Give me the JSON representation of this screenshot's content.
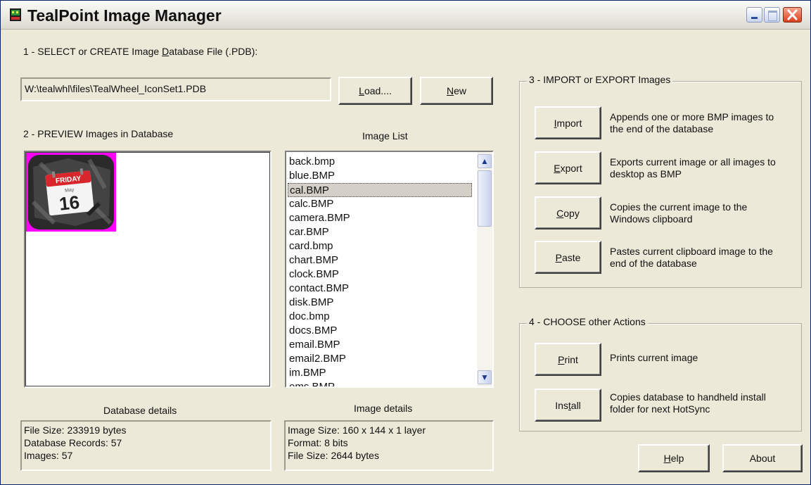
{
  "window": {
    "title": "TealPoint Image Manager"
  },
  "section1": {
    "label_pre": "1 - SELECT or CREATE Image ",
    "label_u": "D",
    "label_post": "atabase File (.PDB):",
    "path_value": "W:\\tealwhl\\files\\TealWheel_IconSet1.PDB",
    "load_u": "L",
    "load_rest": "oad....",
    "new_u": "N",
    "new_rest": "ew"
  },
  "section2": {
    "label": "2 - PREVIEW Images in Database",
    "preview_image": {
      "day": "FRIDAY",
      "month": "May",
      "date": "16"
    },
    "image_list_label": "Image List",
    "image_list": [
      "back.bmp",
      "blue.BMP",
      "cal.BMP",
      "calc.BMP",
      "camera.BMP",
      "car.BMP",
      "card.bmp",
      "chart.BMP",
      "clock.BMP",
      "contact.BMP",
      "disk.BMP",
      "doc.bmp",
      "docs.BMP",
      "email.BMP",
      "email2.BMP",
      "im.BMP",
      "ems.BMP"
    ],
    "selected_item": "cal.BMP"
  },
  "database_details": {
    "label": "Database details",
    "lines": [
      "File Size: 233919 bytes",
      "Database Records: 57",
      "Images: 57"
    ]
  },
  "image_details": {
    "label": "Image details",
    "lines": [
      "Image Size: 160 x 144 x 1 layer",
      "Format: 8 bits",
      "File Size: 2644 bytes"
    ]
  },
  "section3": {
    "legend": "3 - IMPORT or EXPORT Images",
    "import": {
      "u": "I",
      "rest": "mport",
      "desc": "Appends one or more BMP images to the end of the database"
    },
    "export": {
      "u": "E",
      "rest": "xport",
      "desc": "Exports current image or all images to desktop as BMP"
    },
    "copy": {
      "u": "C",
      "rest": "opy",
      "desc": "Copies the current image to the Windows clipboard"
    },
    "paste": {
      "u": "P",
      "rest": "aste",
      "desc": "Pastes current clipboard image to the end of the database"
    }
  },
  "section4": {
    "legend": "4 - CHOOSE other Actions",
    "print": {
      "u": "P",
      "rest": "rint",
      "desc": "Prints current image"
    },
    "install": {
      "pre": "Ins",
      "u": "t",
      "rest": "all",
      "desc": "Copies database to handheld install folder for next HotSync"
    }
  },
  "footer": {
    "help_u": "H",
    "help_rest": "elp",
    "about": "About"
  },
  "colors": {
    "selection": "#d4d0c8",
    "window_bg": "#ece9d8",
    "close_button": "#d8411f",
    "calendar_red": "#d9262c",
    "preview_border": "#ff00ff"
  }
}
